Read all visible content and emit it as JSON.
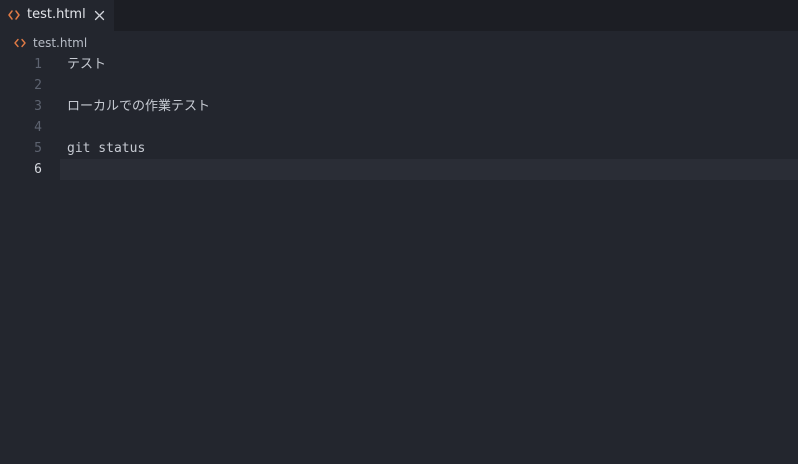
{
  "tab": {
    "label": "test.html",
    "icon": "code-file-icon",
    "close_icon": "close-icon"
  },
  "breadcrumb": {
    "label": "test.html",
    "icon": "code-file-icon"
  },
  "editor": {
    "current_line": 6,
    "lines": [
      {
        "number": "1",
        "text": "テスト"
      },
      {
        "number": "2",
        "text": ""
      },
      {
        "number": "3",
        "text": "ローカルでの作業テスト"
      },
      {
        "number": "4",
        "text": ""
      },
      {
        "number": "5",
        "text": "git status"
      },
      {
        "number": "6",
        "text": ""
      }
    ]
  },
  "colors": {
    "file_icon": "#e07a45",
    "background": "#23262e",
    "tabbar": "#1c1e24"
  }
}
